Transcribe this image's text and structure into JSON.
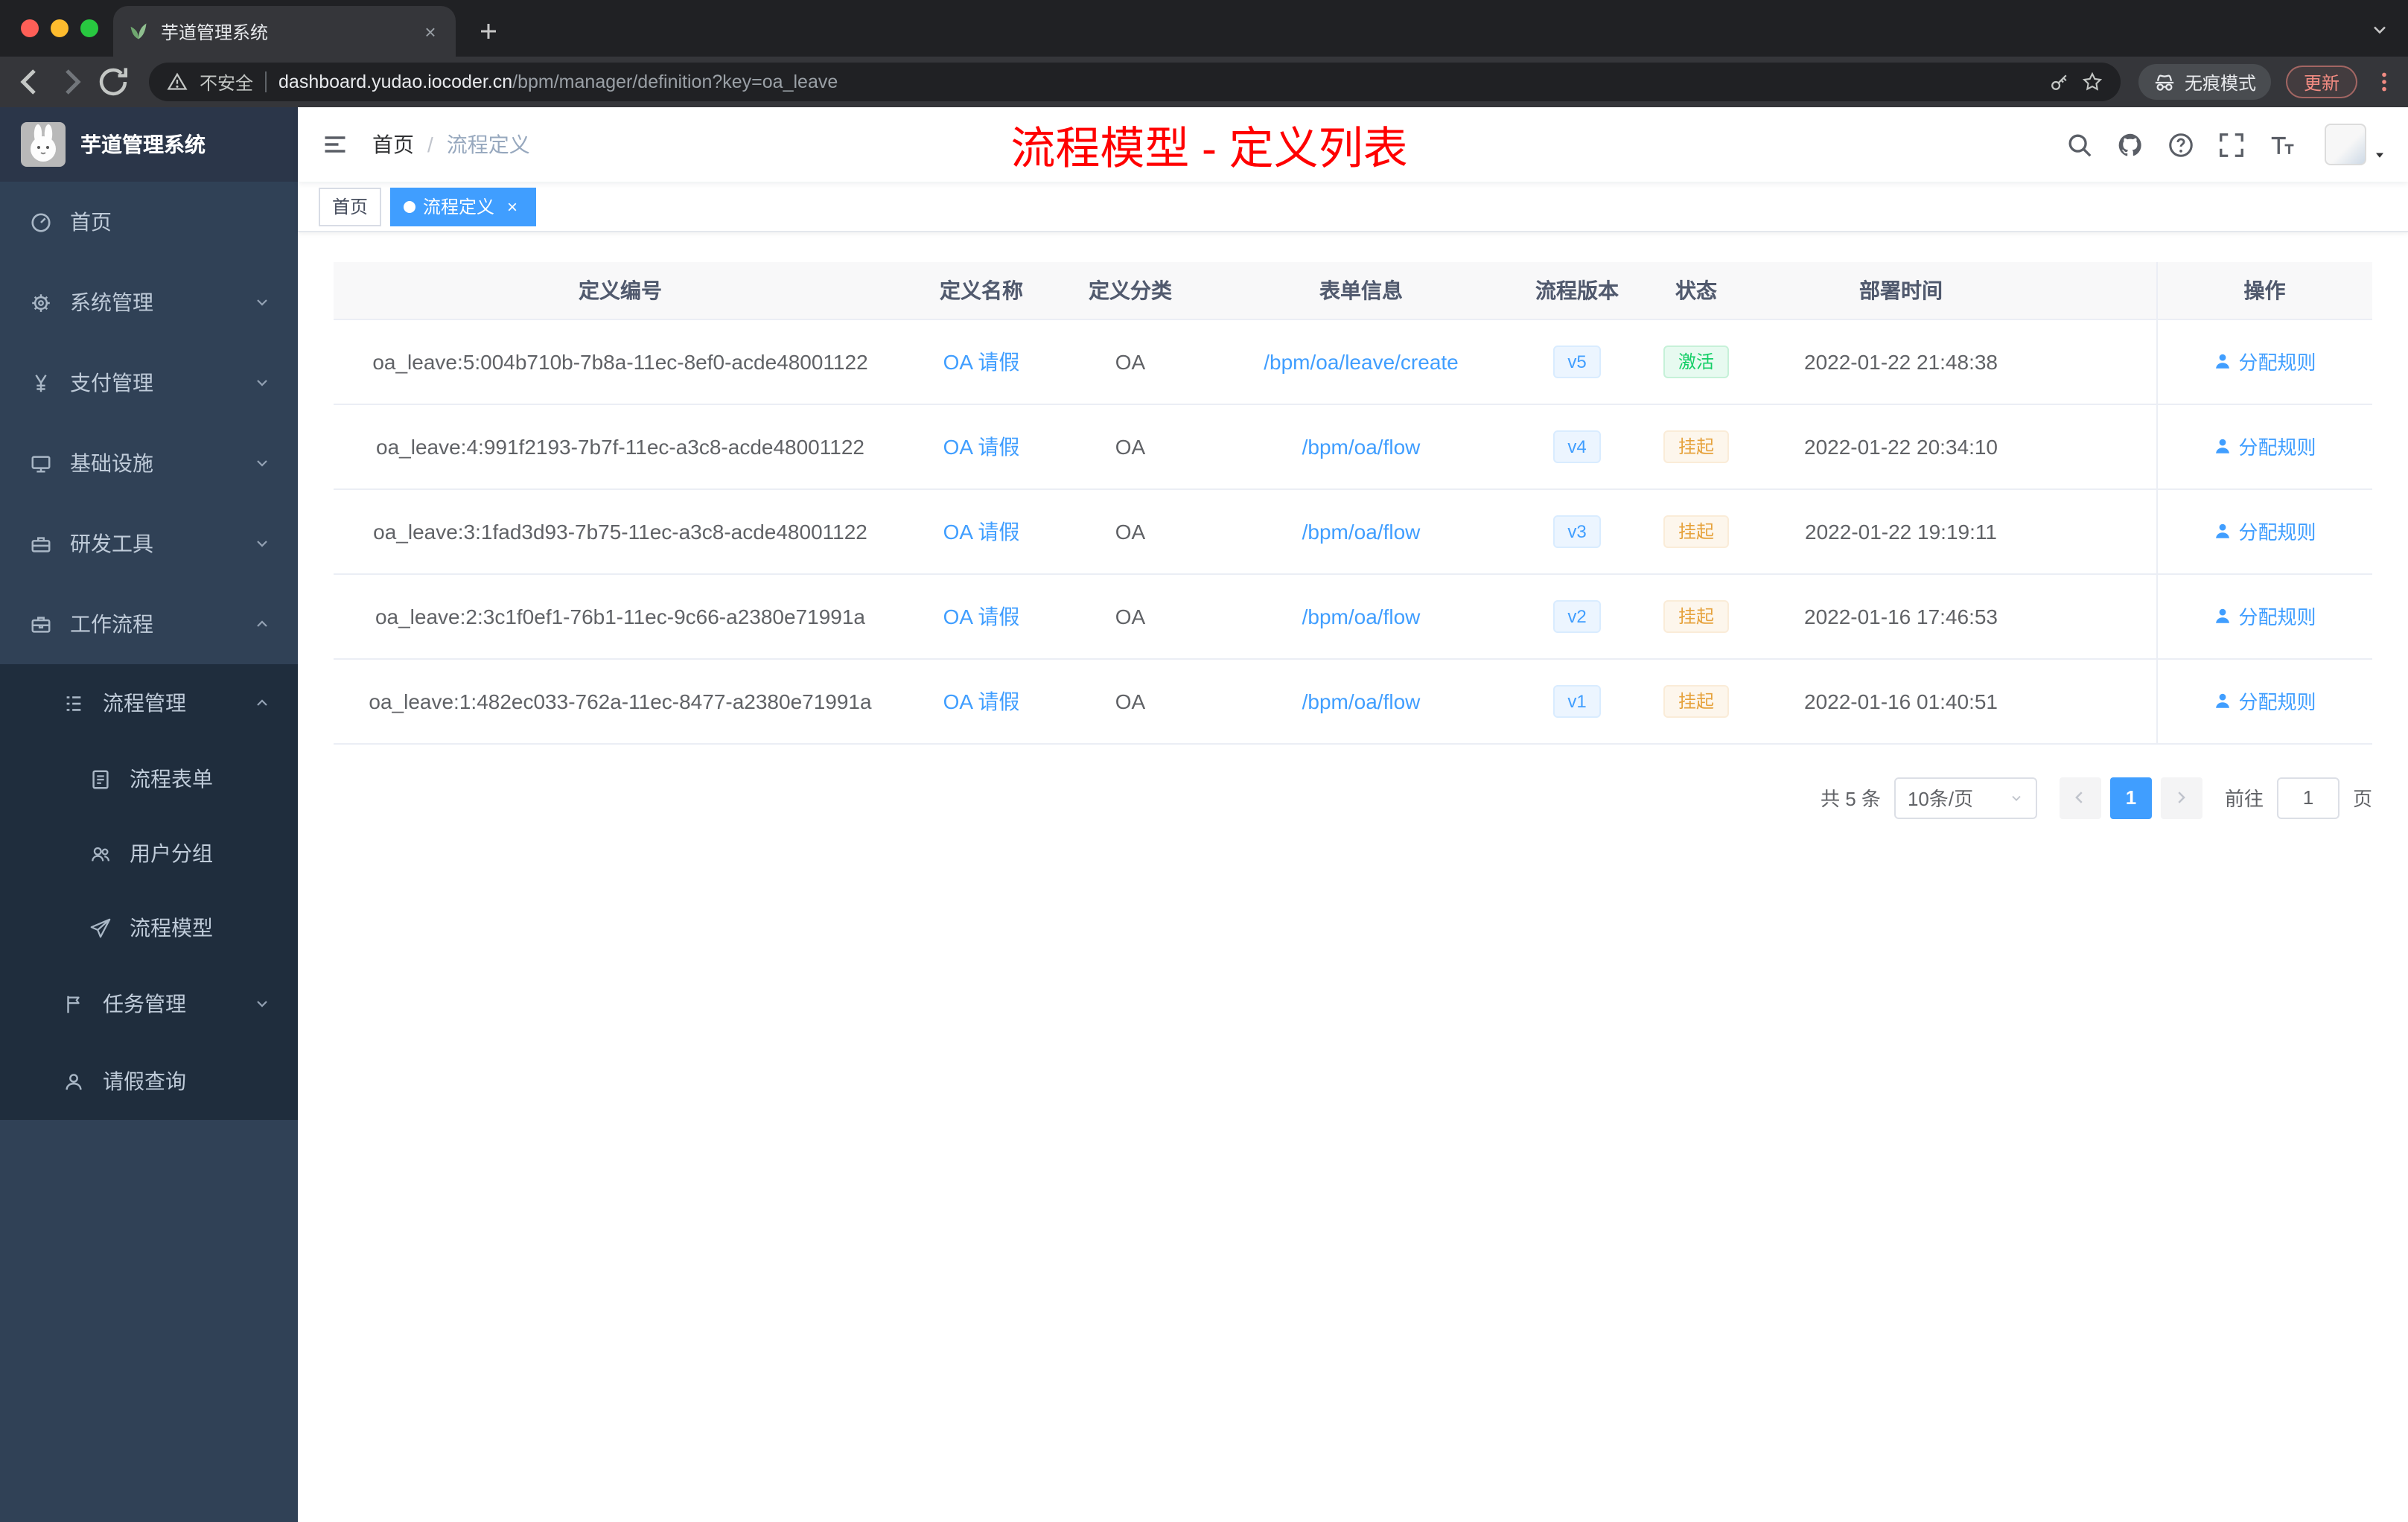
{
  "browser": {
    "tab": {
      "title": "芋道管理系统"
    },
    "security_label": "不安全",
    "url_host": "dashboard.yudao.iocoder.cn",
    "url_path": "/bpm/manager/definition?key=oa_leave",
    "incognito_label": "无痕模式",
    "update_label": "更新",
    "traffic_light_colors": [
      "#ff5f57",
      "#febc2e",
      "#28c840"
    ]
  },
  "sidebar": {
    "logo_title": "芋道管理系统",
    "menu": [
      {
        "key": "home",
        "label": "首页",
        "icon": "dashboard-icon",
        "level": 1,
        "chevron": null
      },
      {
        "key": "system-mgmt",
        "label": "系统管理",
        "icon": "gear-icon",
        "level": 1,
        "chevron": "down"
      },
      {
        "key": "payment-mgmt",
        "label": "支付管理",
        "icon": "yen-icon",
        "level": 1,
        "chevron": "down"
      },
      {
        "key": "infrastructure",
        "label": "基础设施",
        "icon": "monitor-icon",
        "level": 1,
        "chevron": "down"
      },
      {
        "key": "dev-tools",
        "label": "研发工具",
        "icon": "toolbox-icon",
        "level": 1,
        "chevron": "down"
      },
      {
        "key": "workflow",
        "label": "工作流程",
        "icon": "briefcase-icon",
        "level": 1,
        "chevron": "up"
      },
      {
        "key": "process-mgmt",
        "label": "流程管理",
        "icon": "tree-icon",
        "level": 2,
        "chevron": "up"
      },
      {
        "key": "process-form",
        "label": "流程表单",
        "icon": "form-icon",
        "level": 3,
        "chevron": null
      },
      {
        "key": "user-group",
        "label": "用户分组",
        "icon": "users-icon",
        "level": 3,
        "chevron": null
      },
      {
        "key": "process-model",
        "label": "流程模型",
        "icon": "send-icon",
        "level": 3,
        "chevron": null
      },
      {
        "key": "task-mgmt",
        "label": "任务管理",
        "icon": "flag-icon",
        "level": 2,
        "chevron": "down"
      },
      {
        "key": "leave-query",
        "label": "请假查询",
        "icon": "user-icon",
        "level": 2,
        "chevron": null
      }
    ]
  },
  "navbar": {
    "breadcrumb": [
      {
        "label": "首页"
      },
      {
        "label": "流程定义"
      }
    ],
    "breadcrumb_separator": "/",
    "overlay_title": "流程模型 - 定义列表",
    "overlay_color": "#ff0000",
    "icons": [
      "search-icon",
      "github-icon",
      "question-icon",
      "fullscreen-icon",
      "font-size-icon"
    ]
  },
  "tags": [
    {
      "key": "home",
      "label": "首页",
      "active": false,
      "closable": false
    },
    {
      "key": "process-definition",
      "label": "流程定义",
      "active": true,
      "closable": true
    }
  ],
  "table": {
    "columns": [
      "定义编号",
      "定义名称",
      "定义分类",
      "表单信息",
      "流程版本",
      "状态",
      "部署时间",
      "操作"
    ],
    "action_label": "分配规则",
    "rows": [
      {
        "id": "oa_leave:5:004b710b-7b8a-11ec-8ef0-acde48001122",
        "name": "OA 请假",
        "category": "OA",
        "form": "/bpm/oa/leave/create",
        "version": "v5",
        "status": "激活",
        "status_type": "success",
        "deploy_time": "2022-01-22 21:48:38"
      },
      {
        "id": "oa_leave:4:991f2193-7b7f-11ec-a3c8-acde48001122",
        "name": "OA 请假",
        "category": "OA",
        "form": "/bpm/oa/flow",
        "version": "v4",
        "status": "挂起",
        "status_type": "warning",
        "deploy_time": "2022-01-22 20:34:10"
      },
      {
        "id": "oa_leave:3:1fad3d93-7b75-11ec-a3c8-acde48001122",
        "name": "OA 请假",
        "category": "OA",
        "form": "/bpm/oa/flow",
        "version": "v3",
        "status": "挂起",
        "status_type": "warning",
        "deploy_time": "2022-01-22 19:19:11"
      },
      {
        "id": "oa_leave:2:3c1f0ef1-76b1-11ec-9c66-a2380e71991a",
        "name": "OA 请假",
        "category": "OA",
        "form": "/bpm/oa/flow",
        "version": "v2",
        "status": "挂起",
        "status_type": "warning",
        "deploy_time": "2022-01-16 17:46:53"
      },
      {
        "id": "oa_leave:1:482ec033-762a-11ec-8477-a2380e71991a",
        "name": "OA 请假",
        "category": "OA",
        "form": "/bpm/oa/flow",
        "version": "v1",
        "status": "挂起",
        "status_type": "warning",
        "deploy_time": "2022-01-16 01:40:51"
      }
    ]
  },
  "pagination": {
    "total_label": "共 5 条",
    "page_size_label": "10条/页",
    "current_page": "1",
    "goto_label": "前往",
    "goto_value": "1",
    "page_unit_label": "页"
  },
  "colors": {
    "accent": "#409eff",
    "success": "#13ce66",
    "warning": "#e6a23c",
    "sidebar_bg": "#304156",
    "submenu_bg": "#1f2d3d",
    "overlay_red": "#ff0000"
  }
}
